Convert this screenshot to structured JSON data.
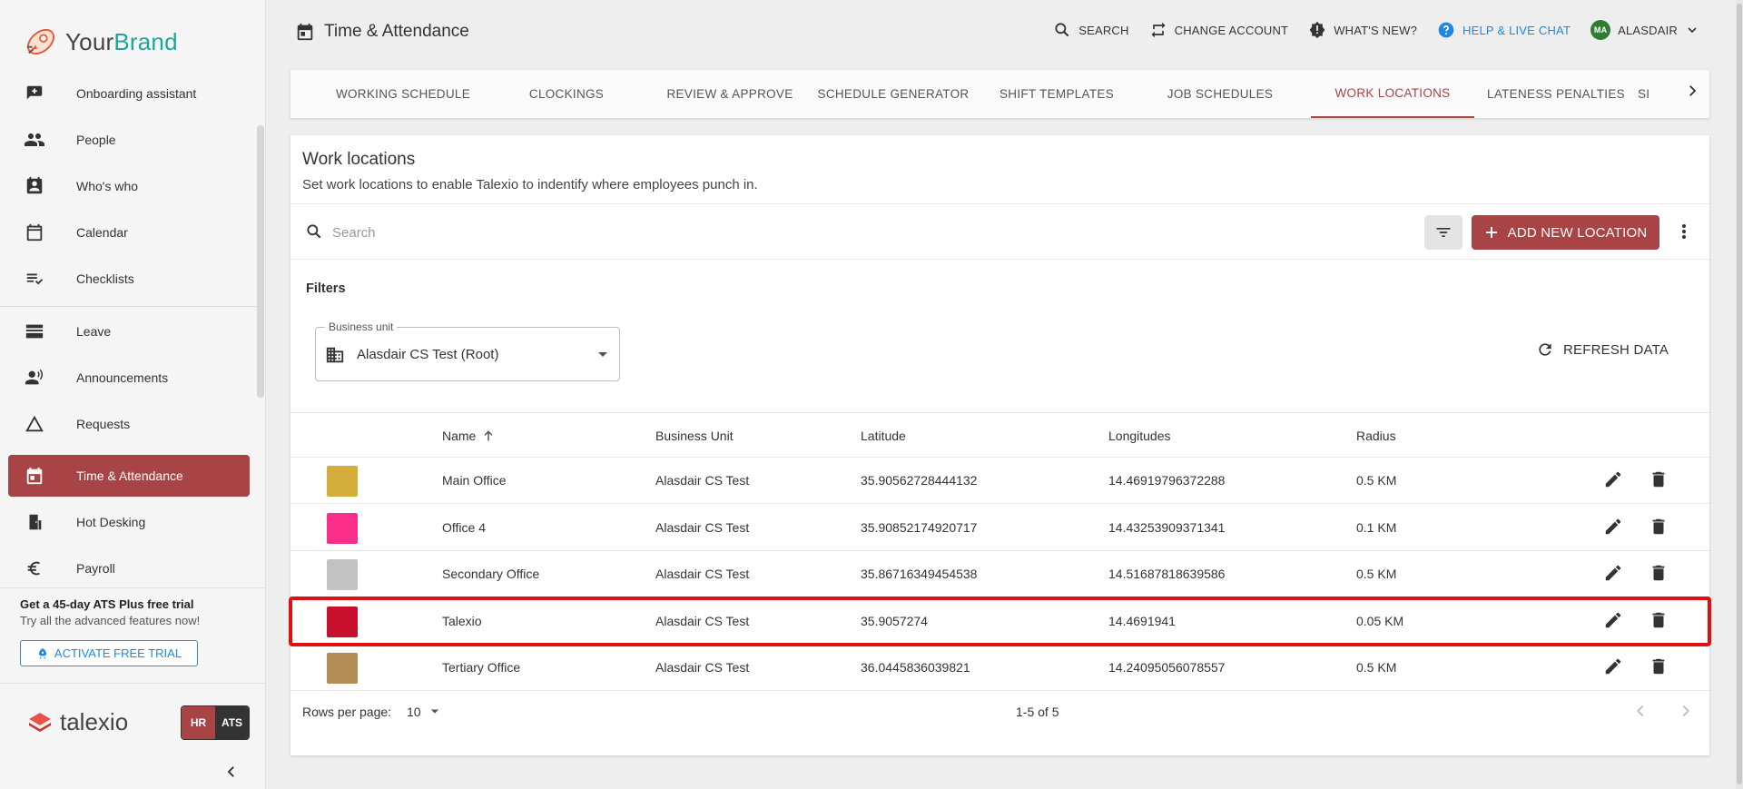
{
  "brand": {
    "part1": "Your",
    "part2": "Brand"
  },
  "sidebar": {
    "items": [
      {
        "label": "Onboarding assistant",
        "icon": "onboarding-icon"
      },
      {
        "label": "People",
        "icon": "people-icon"
      },
      {
        "label": "Who's who",
        "icon": "contact-card-icon"
      },
      {
        "label": "Calendar",
        "icon": "calendar-icon"
      },
      {
        "label": "Checklists",
        "icon": "checklist-icon"
      },
      {
        "label": "Leave",
        "icon": "leave-icon"
      },
      {
        "label": "Announcements",
        "icon": "megaphone-icon"
      },
      {
        "label": "Requests",
        "icon": "triangle-icon"
      },
      {
        "label": "Time & Attendance",
        "icon": "calendar-clock-icon",
        "active": true
      },
      {
        "label": "Hot Desking",
        "icon": "door-icon"
      },
      {
        "label": "Payroll",
        "icon": "euro-icon"
      }
    ],
    "promo": {
      "title": "Get a 45-day ATS Plus free trial",
      "subtitle": "Try all the advanced features now!",
      "button": "ACTIVATE FREE TRIAL"
    },
    "footer": {
      "logo_text": "talexio",
      "hr": "HR",
      "ats": "ATS"
    }
  },
  "header": {
    "title": "Time & Attendance",
    "actions": {
      "search": "SEARCH",
      "change_account": "CHANGE ACCOUNT",
      "whats_new": "WHAT'S NEW?",
      "help": "HELP & LIVE CHAT",
      "user_initials": "MA",
      "user_name": "ALASDAIR"
    }
  },
  "tabs": [
    "WORKING SCHEDULE",
    "CLOCKINGS",
    "REVIEW & APPROVE",
    "SCHEDULE GENERATOR",
    "SHIFT TEMPLATES",
    "JOB SCHEDULES",
    "WORK LOCATIONS",
    "LATENESS PENALTIES",
    "SI"
  ],
  "active_tab": "WORK LOCATIONS",
  "card": {
    "title": "Work locations",
    "subtitle": "Set work locations to enable Talexio to indentify where employees punch in.",
    "search_placeholder": "Search",
    "add_button": "ADD NEW LOCATION",
    "filters_label": "Filters",
    "business_unit_label": "Business unit",
    "business_unit_value": "Alasdair CS Test (Root)",
    "refresh": "REFRESH DATA"
  },
  "table": {
    "columns": [
      "Name",
      "Business Unit",
      "Latitude",
      "Longitudes",
      "Radius"
    ],
    "rows": [
      {
        "color": "#d4ac3a",
        "name": "Main Office",
        "business_unit": "Alasdair CS Test",
        "latitude": "35.90562728444132",
        "longitude": "14.46919796372288",
        "radius": "0.5 KM"
      },
      {
        "color": "#fb2d8a",
        "name": "Office 4",
        "business_unit": "Alasdair CS Test",
        "latitude": "35.90852174920717",
        "longitude": "14.43253909371341",
        "radius": "0.1 KM"
      },
      {
        "color": "#c2c2c2",
        "name": "Secondary Office",
        "business_unit": "Alasdair CS Test",
        "latitude": "35.86716349454538",
        "longitude": "14.51687818639586",
        "radius": "0.5 KM"
      },
      {
        "color": "#c8102e",
        "name": "Talexio",
        "business_unit": "Alasdair CS Test",
        "latitude": "35.9057274",
        "longitude": "14.4691941",
        "radius": "0.05 KM"
      },
      {
        "color": "#b48c55",
        "name": "Tertiary Office",
        "business_unit": "Alasdair CS Test",
        "latitude": "36.0445836039821",
        "longitude": "14.24095056078557",
        "radius": "0.5 KM"
      }
    ],
    "rows_per_page_label": "Rows per page:",
    "rows_per_page": "10",
    "range": "1-5 of 5"
  },
  "colors": {
    "accent": "#a84445",
    "help": "#1e88e5",
    "highlight": "#e01010"
  }
}
